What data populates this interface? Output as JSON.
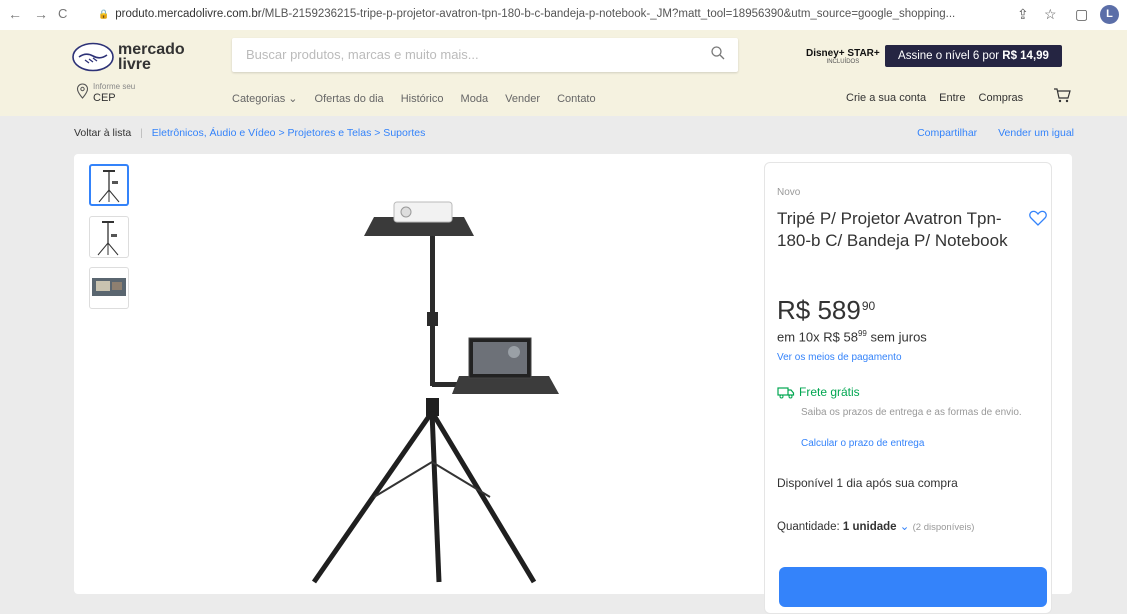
{
  "browser": {
    "back": "←",
    "forward": "→",
    "reload": "C",
    "url_host": "produto.mercadolivre.com.br",
    "url_path": "/MLB-2159236215-tripe-p-projetor-avatron-tpn-180-b-c-bandeja-p-notebook-_JM?matt_tool=18956390&utm_source=google_shopping...",
    "profile_initial": "L"
  },
  "header": {
    "logo_line1": "mercado",
    "logo_line2": "livre",
    "search_placeholder": "Buscar produtos, marcas e muito mais...",
    "disney_label": "Disney+ STAR+",
    "disney_sub": "INCLUÍDOS",
    "promo_text": "Assine o nível 6 por",
    "promo_price": "R$ 14,99",
    "cep_small": "Informe seu",
    "cep_main": "CEP",
    "nav": [
      "Categorias ⌄",
      "Ofertas do dia",
      "Histórico",
      "Moda",
      "Vender",
      "Contato"
    ],
    "account": [
      "Crie a sua conta",
      "Entre",
      "Compras"
    ]
  },
  "breadcrumb": {
    "back": "Voltar à lista",
    "path": "Eletrônicos, Áudio e Vídeo > Projetores e Telas > Suportes",
    "share": "Compartilhar",
    "sell_same": "Vender um igual"
  },
  "product": {
    "condition": "Novo",
    "title": "Tripé P/ Projetor Avatron Tpn-180-b C/ Bandeja P/ Notebook",
    "price_int": "R$ 589",
    "price_cents": "90",
    "install_prefix": "em 10x R$ 58",
    "install_cents": "99",
    "install_suffix": " sem juros",
    "payment_link": "Ver os meios de pagamento",
    "shipping_title": "Frete grátis",
    "shipping_sub": "Saiba os prazos de entrega e as formas de envio.",
    "shipping_calc": "Calcular o prazo de entrega",
    "availability": "Disponível 1 dia após sua compra",
    "qty_label": "Quantidade:",
    "qty_value": "1 unidade",
    "qty_avail": "(2 disponíveis)"
  },
  "colors": {
    "header_bg": "#f5f2e0",
    "link": "#3483fa",
    "free_shipping": "#00a650",
    "promo_bg": "#252542"
  }
}
